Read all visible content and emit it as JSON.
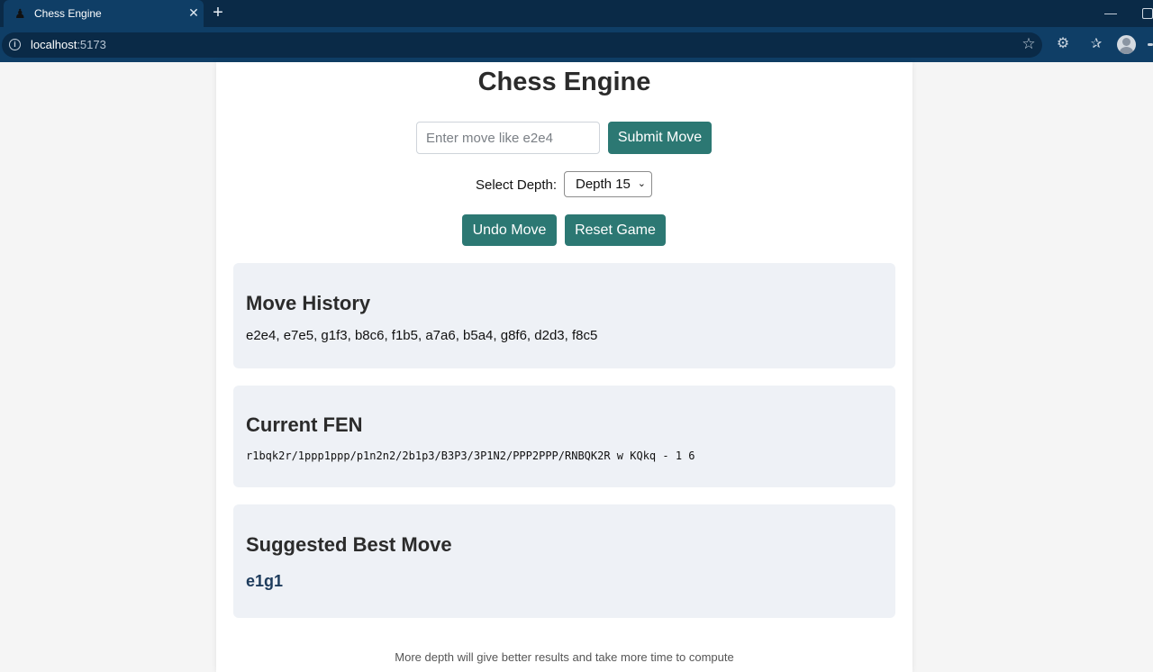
{
  "browser": {
    "tab_title": "Chess Engine",
    "tab_icon": "chess-pawn-icon",
    "url_host": "localhost",
    "url_port": ":5173"
  },
  "page": {
    "title": "Chess Engine",
    "move_input_placeholder": "Enter move like e2e4",
    "submit_label": "Submit Move",
    "depth_label": "Select Depth:",
    "depth_selected": "Depth 15",
    "undo_label": "Undo Move",
    "reset_label": "Reset Game"
  },
  "history": {
    "heading": "Move History",
    "moves": "e2e4, e7e5, g1f3, b8c6, f1b5, a7a6, b5a4, g8f6, d2d3, f8c5"
  },
  "fen": {
    "heading": "Current FEN",
    "value": "r1bqk2r/1ppp1ppp/p1n2n2/2b1p3/B3P3/3P1N2/PPP2PPP/RNBQK2R w KQkq - 1 6"
  },
  "best": {
    "heading": "Suggested Best Move",
    "move": "e1g1"
  },
  "footnote": "More depth will give better results and take more time to compute",
  "colors": {
    "accent": "#2c7873",
    "panel_bg": "#eef1f6",
    "best_move": "#1d3b5c"
  }
}
